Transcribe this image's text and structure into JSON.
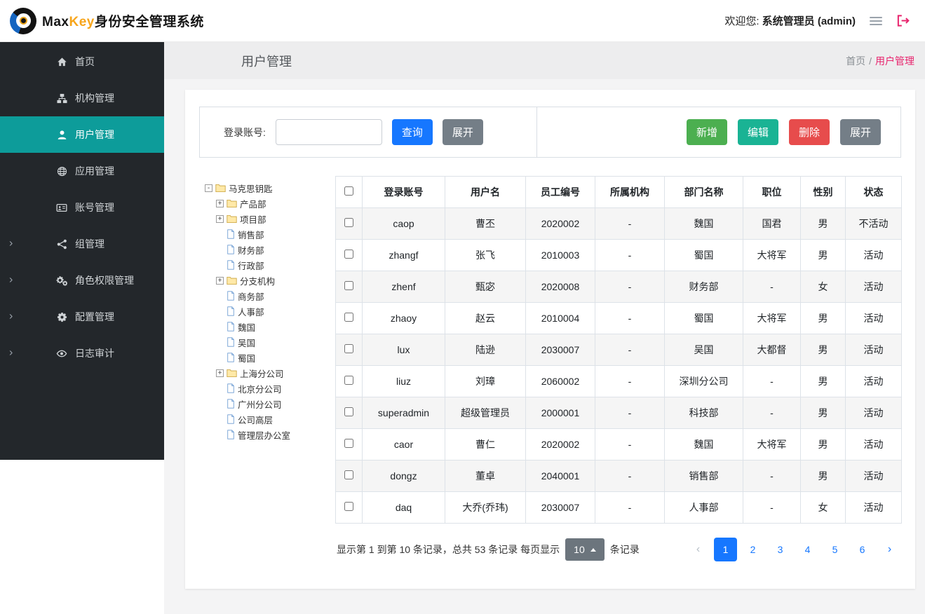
{
  "header": {
    "brand": {
      "max": "Max",
      "key": "Key",
      "suffix": "身份安全管理系统"
    },
    "welcome_label": "欢迎您:",
    "welcome_user": "系统管理员 (admin)"
  },
  "sidebar": {
    "items": [
      {
        "id": "home",
        "label": "首页",
        "icon": "home"
      },
      {
        "id": "org",
        "label": "机构管理",
        "icon": "sitemap"
      },
      {
        "id": "users",
        "label": "用户管理",
        "icon": "user",
        "active": true
      },
      {
        "id": "apps",
        "label": "应用管理",
        "icon": "globe"
      },
      {
        "id": "accounts",
        "label": "账号管理",
        "icon": "idcard"
      },
      {
        "id": "groups",
        "label": "组管理",
        "icon": "share",
        "expandable": true
      },
      {
        "id": "roles",
        "label": "角色权限管理",
        "icon": "gears",
        "expandable": true
      },
      {
        "id": "config",
        "label": "配置管理",
        "icon": "gear",
        "expandable": true
      },
      {
        "id": "audit",
        "label": "日志审计",
        "icon": "eye",
        "expandable": true
      }
    ]
  },
  "page": {
    "title": "用户管理",
    "breadcrumb_home": "首页",
    "breadcrumb_sep": "/",
    "breadcrumb_current": "用户管理"
  },
  "toolbar": {
    "search_label": "登录账号:",
    "search_value": "",
    "query_label": "查询",
    "expand_label": "展开",
    "add_label": "新增",
    "edit_label": "编辑",
    "delete_label": "删除",
    "expand2_label": "展开"
  },
  "tree": {
    "nodes": [
      {
        "label": "马克思钥匙",
        "level": 0,
        "type": "folder",
        "toggle": "minus"
      },
      {
        "label": "产品部",
        "level": 1,
        "type": "folder",
        "toggle": "plus"
      },
      {
        "label": "项目部",
        "level": 1,
        "type": "folder",
        "toggle": "plus"
      },
      {
        "label": "销售部",
        "level": 1,
        "type": "leaf"
      },
      {
        "label": "财务部",
        "level": 1,
        "type": "leaf"
      },
      {
        "label": "行政部",
        "level": 1,
        "type": "leaf"
      },
      {
        "label": "分支机构",
        "level": 1,
        "type": "folder",
        "toggle": "plus"
      },
      {
        "label": "商务部",
        "level": 1,
        "type": "leaf"
      },
      {
        "label": "人事部",
        "level": 1,
        "type": "leaf"
      },
      {
        "label": "魏国",
        "level": 1,
        "type": "leaf"
      },
      {
        "label": "吴国",
        "level": 1,
        "type": "leaf"
      },
      {
        "label": "蜀国",
        "level": 1,
        "type": "leaf"
      },
      {
        "label": "上海分公司",
        "level": 1,
        "type": "folder",
        "toggle": "plus"
      },
      {
        "label": "北京分公司",
        "level": 1,
        "type": "leaf"
      },
      {
        "label": "广州分公司",
        "level": 1,
        "type": "leaf"
      },
      {
        "label": "公司高层",
        "level": 1,
        "type": "leaf"
      },
      {
        "label": "管理层办公室",
        "level": 1,
        "type": "leaf"
      }
    ]
  },
  "table": {
    "columns": [
      "登录账号",
      "用户名",
      "员工编号",
      "所属机构",
      "部门名称",
      "职位",
      "性别",
      "状态"
    ],
    "rows": [
      [
        "caop",
        "曹丕",
        "2020002",
        "-",
        "魏国",
        "国君",
        "男",
        "不活动"
      ],
      [
        "zhangf",
        "张飞",
        "2010003",
        "-",
        "蜀国",
        "大将军",
        "男",
        "活动"
      ],
      [
        "zhenf",
        "甄宓",
        "2020008",
        "-",
        "财务部",
        "-",
        "女",
        "活动"
      ],
      [
        "zhaoy",
        "赵云",
        "2010004",
        "-",
        "蜀国",
        "大将军",
        "男",
        "活动"
      ],
      [
        "lux",
        "陆逊",
        "2030007",
        "-",
        "吴国",
        "大都督",
        "男",
        "活动"
      ],
      [
        "liuz",
        "刘璋",
        "2060002",
        "-",
        "深圳分公司",
        "-",
        "男",
        "活动"
      ],
      [
        "superadmin",
        "超级管理员",
        "2000001",
        "-",
        "科技部",
        "-",
        "男",
        "活动"
      ],
      [
        "caor",
        "曹仁",
        "2020002",
        "-",
        "魏国",
        "大将军",
        "男",
        "活动"
      ],
      [
        "dongz",
        "董卓",
        "2040001",
        "-",
        "销售部",
        "-",
        "男",
        "活动"
      ],
      [
        "daq",
        "大乔(乔玮)",
        "2030007",
        "-",
        "人事部",
        "-",
        "女",
        "活动"
      ]
    ]
  },
  "pagination": {
    "info_left": "显示第 1 到第 10 条记录，总共 53 条记录 每页显示",
    "page_size": "10",
    "info_right": "条记录",
    "pages": [
      {
        "label": "‹",
        "kind": "prev"
      },
      {
        "label": "1",
        "active": true
      },
      {
        "label": "2"
      },
      {
        "label": "3"
      },
      {
        "label": "4"
      },
      {
        "label": "5"
      },
      {
        "label": "6"
      },
      {
        "label": "›",
        "kind": "next"
      }
    ]
  },
  "colors": {
    "primary_blue": "#1677ff",
    "btn_gray": "#747e87",
    "btn_green": "#4caf50",
    "btn_teal": "#1ab394",
    "btn_red": "#e74c4c",
    "sidebar_active_teal": "#0d9c9a",
    "breadcrumb_pink": "#e8246d",
    "logout_pink": "#e8246d",
    "brand_orange": "#f7a51b"
  }
}
